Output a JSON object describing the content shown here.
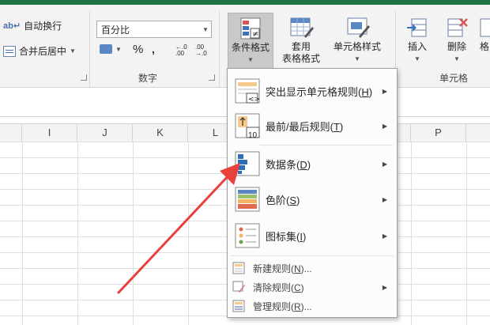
{
  "ribbon": {
    "alignment": {
      "wrap_text_label": "自动换行",
      "merge_center_label": "合并后居中",
      "group_label": "ב"
    },
    "number": {
      "format_value": "百分比",
      "percent_symbol": "%",
      "comma_symbol": "，",
      "group_label": "数字"
    },
    "styles": {
      "conditional_formatting_label": "条件格式",
      "format_as_table_line1": "套用",
      "format_as_table_line2": "表格格式",
      "cell_styles_label": "单元格样式"
    },
    "cells": {
      "insert_label": "插入",
      "delete_label": "删除",
      "format_partial_label": "格",
      "group_label": "单元格"
    }
  },
  "columns": [
    "I",
    "J",
    "K",
    "L",
    "P"
  ],
  "menu": {
    "items": [
      {
        "label": "突出显示单元格规则(",
        "key": "H",
        "tail": ")",
        "icon": "highlight-rules-icon"
      },
      {
        "label": "最前/最后规则(",
        "key": "T",
        "tail": ")",
        "icon": "top-bottom-rules-icon",
        "icon_text": "10"
      },
      {
        "label": "数据条(",
        "key": "D",
        "tail": ")",
        "icon": "data-bars-icon"
      },
      {
        "label": "色阶(",
        "key": "S",
        "tail": ")",
        "icon": "color-scales-icon"
      },
      {
        "label": "图标集(",
        "key": "I",
        "tail": ")",
        "icon": "icon-sets-icon"
      }
    ],
    "small_items": [
      {
        "label": "新建规则(",
        "key": "N",
        "tail": ")...",
        "icon": "new-rule-icon"
      },
      {
        "label": "清除规则(",
        "key": "C",
        "tail": ")",
        "icon": "clear-rules-icon"
      },
      {
        "label": "管理规则(",
        "key": "R",
        "tail": ")...",
        "icon": "manage-rules-icon"
      }
    ]
  },
  "colors": {
    "title_bar": "#217346",
    "arrow": "#e8403a",
    "data_bar_blue": "#2e6fb8"
  }
}
